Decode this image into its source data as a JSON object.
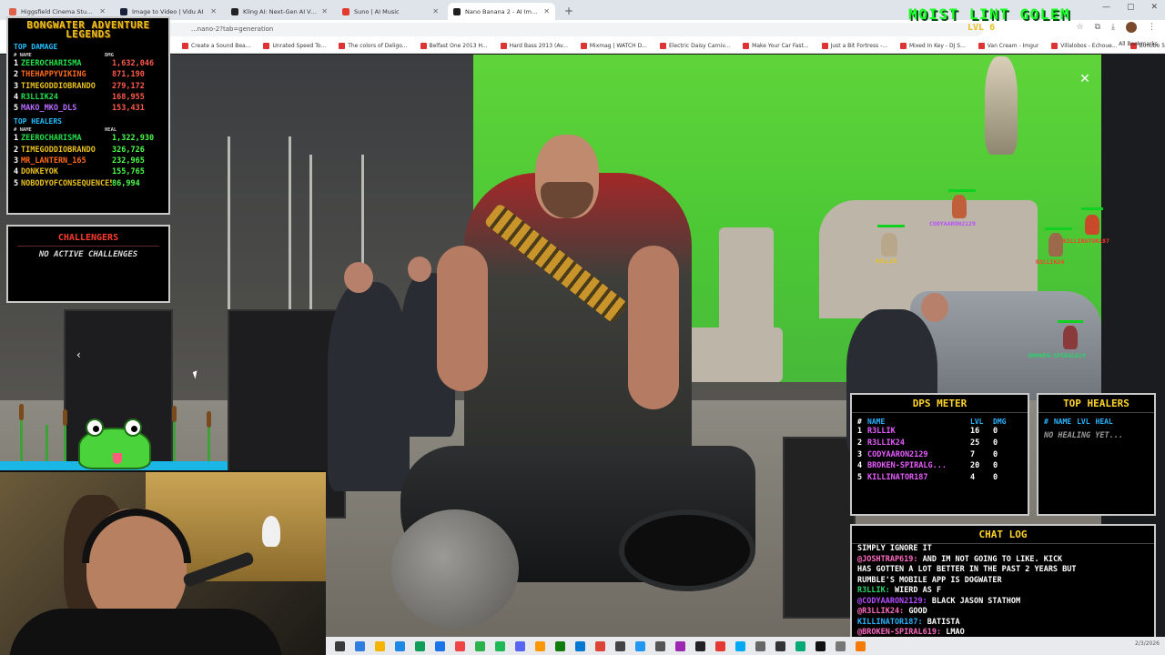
{
  "browser": {
    "tabs": [
      {
        "label": "Higgsfield Cinema Studio | Prof...",
        "color": "#e0604a",
        "active": false
      },
      {
        "label": "Image to Video | Vidu AI",
        "color": "#1a1f3a",
        "active": false
      },
      {
        "label": "Kling AI: Next-Gen AI Video & ...",
        "color": "#222222",
        "active": false
      },
      {
        "label": "Suno | AI Music",
        "color": "#e23b2e",
        "active": false
      },
      {
        "label": "Nano Banana 2 - AI Image Gen...",
        "color": "#1f1f1f",
        "active": true
      }
    ],
    "new_tab": "+",
    "url": "...nano-2?tab=generation",
    "bookmarks": [
      "Create a Sound Bea...",
      "Unrated Speed To...",
      "The colors of Deligo...",
      "Belfast One 2013 H...",
      "Hard Bass 2013 (Av...",
      "Mixmag | WATCH D...",
      "Electric Daisy Carniv...",
      "Make Your Car Fast...",
      "Just a Bit Fortress -...",
      "Mixed In Key - DJ S...",
      "Van Cream - Imgur",
      "Villalobos - Echoue...",
      "Bonobo 50 m t...",
      "Enter..."
    ],
    "all_bookmarks": "All Bookmarks"
  },
  "stream": {
    "legends": {
      "title": "BONGWATER ADVENTURE LEGENDS",
      "top_damage_label": "TOP DAMAGE",
      "col_name": "# NAME",
      "col_dmg": "DMG",
      "col_heal": "HEAL",
      "top_healers_label": "TOP HEALERS",
      "damage": [
        {
          "rank": "1",
          "name": "ZEEROCHARISMA",
          "value": "1,632,046",
          "cls": "c1"
        },
        {
          "rank": "2",
          "name": "THEHAPPYVIKING",
          "value": "871,190",
          "cls": "c2"
        },
        {
          "rank": "3",
          "name": "TIMEGODDIOBRANDO",
          "value": "279,172",
          "cls": "c3"
        },
        {
          "rank": "4",
          "name": "R3LLIK24",
          "value": "168,955",
          "cls": "c1"
        },
        {
          "rank": "5",
          "name": "MAKO_MKO_DLS",
          "value": "153,431",
          "cls": "c5"
        }
      ],
      "healers": [
        {
          "rank": "1",
          "name": "ZEEROCHARISMA",
          "value": "1,322,930",
          "cls": "c1"
        },
        {
          "rank": "2",
          "name": "TIMEGODDIOBRANDO",
          "value": "326,726",
          "cls": "c3"
        },
        {
          "rank": "3",
          "name": "MR_LANTERN_165",
          "value": "232,965",
          "cls": "c2"
        },
        {
          "rank": "4",
          "name": "DONKEYOK",
          "value": "155,765",
          "cls": "c3"
        },
        {
          "rank": "5",
          "name": "NOBODYOFCONSEQUENCE50",
          "value": "86,994",
          "cls": "c3"
        }
      ]
    },
    "challengers": {
      "title": "CHALLENGERS",
      "empty": "NO ACTIVE CHALLENGES"
    },
    "boss": {
      "name": "MOIST LINT GOLEM",
      "level": "LVL 6"
    },
    "players": [
      {
        "name": "CODYAARON2129",
        "color": "#b44dff"
      },
      {
        "name": "R3LLIK",
        "color": "#e8c020"
      },
      {
        "name": "KILLINATOR187",
        "color": "#ff3b30"
      },
      {
        "name": "R3LLIK24",
        "color": "#ff3b30"
      },
      {
        "name": "BROKEN-SPIRAL619",
        "color": "#2ad46a"
      }
    ],
    "dps": {
      "title": "DPS METER",
      "head": {
        "num": "#",
        "name": "NAME",
        "lvl": "LVL",
        "dmg": "DMG"
      },
      "rows": [
        {
          "rank": "1",
          "name": "R3LLIK",
          "lvl": "16",
          "dmg": "0"
        },
        {
          "rank": "2",
          "name": "R3LLIK24",
          "lvl": "25",
          "dmg": "0"
        },
        {
          "rank": "3",
          "name": "CODYAARON2129",
          "lvl": "7",
          "dmg": "0"
        },
        {
          "rank": "4",
          "name": "BROKEN-SPIRALG...",
          "lvl": "20",
          "dmg": "0"
        },
        {
          "rank": "5",
          "name": "KILLINATOR187",
          "lvl": "4",
          "dmg": "0"
        }
      ]
    },
    "healers_panel": {
      "title": "TOP HEALERS",
      "head": {
        "num": "#",
        "name": "NAME",
        "lvl": "LVL",
        "heal": "HEAL"
      },
      "empty": "NO HEALING YET..."
    },
    "chat": {
      "title": "CHAT LOG",
      "messages": [
        {
          "user": "",
          "text": "SIMPLY IGNORE IT",
          "cls": "u1"
        },
        {
          "user": "@JOSHTRAP619:",
          "text": "AND IM NOT GOING TO LIKE. KICK",
          "cls": "u2"
        },
        {
          "user": "",
          "text": "HAS GOTTEN A LOT BETTER IN THE PAST 2 YEARS BUT",
          "cls": "u2"
        },
        {
          "user": "",
          "text": "RUMBLE'S MOBILE APP IS DOGWATER",
          "cls": "u2"
        },
        {
          "user": "R3LLIK:",
          "text": "WIERD AS F",
          "cls": "u3"
        },
        {
          "user": "@CODYAARON2129:",
          "text": "BLACK JASON STATHOM",
          "cls": "u1"
        },
        {
          "user": "@R3LLIK24:",
          "text": "GOOD",
          "cls": "u2"
        },
        {
          "user": "KILLINATOR187:",
          "text": "BATISTA",
          "cls": "u4"
        },
        {
          "user": "@BROKEN-SPIRAL619:",
          "text": "LMAO",
          "cls": "u2"
        },
        {
          "user": "@R3LLIK24:",
          "text": "MOVIE SET",
          "cls": "u2"
        }
      ]
    }
  },
  "viewer": {
    "close_label": "✕",
    "prev_label": "‹"
  },
  "taskbar": {
    "date": "2/3/2026"
  },
  "colors": {
    "accent_green": "#18ff28",
    "panel_border": "#c9c9c9",
    "gold": "#ffd52a"
  }
}
